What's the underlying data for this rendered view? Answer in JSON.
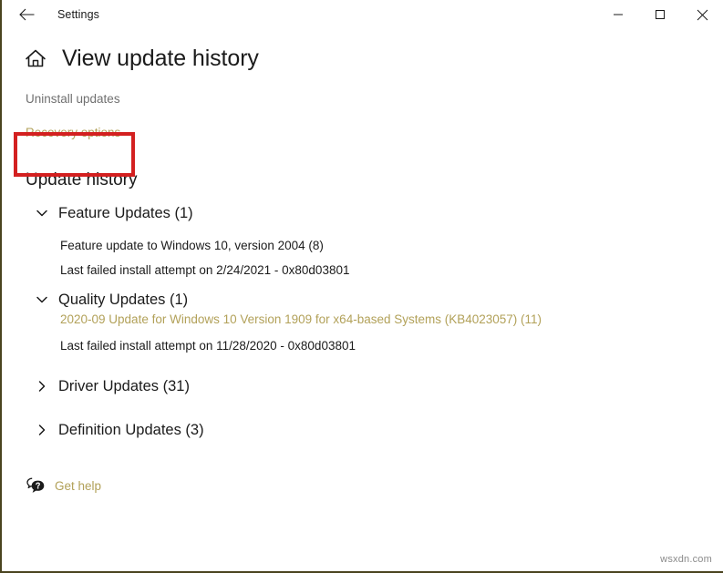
{
  "window": {
    "app_title": "Settings",
    "back_icon": "back-arrow-icon",
    "minimize_label": "Minimize",
    "maximize_label": "Maximize",
    "close_label": "Close"
  },
  "page": {
    "home_icon": "home-icon",
    "title": "View update history",
    "links": [
      {
        "label": "Uninstall updates",
        "color": "#707070",
        "highlighted": true
      },
      {
        "label": "Recovery options",
        "color": "#b2a159",
        "highlighted": false
      }
    ],
    "section_title": "Update history",
    "groups": [
      {
        "label": "Feature Updates (1)",
        "expanded": true,
        "chevron": "chevron-down-icon",
        "items": [
          {
            "name": "Feature update to Windows 10, version 2004 (8)",
            "is_link": false,
            "sub": "Last failed install attempt on 2/24/2021 - 0x80d03801"
          }
        ]
      },
      {
        "label": "Quality Updates (1)",
        "expanded": true,
        "chevron": "chevron-down-icon",
        "items": [
          {
            "name": "2020-09 Update for Windows 10 Version 1909 for x64-based Systems (KB4023057) (11)",
            "is_link": true,
            "sub": "Last failed install attempt on 11/28/2020 - 0x80d03801"
          }
        ]
      },
      {
        "label": "Driver Updates (31)",
        "expanded": false,
        "chevron": "chevron-right-icon",
        "items": []
      },
      {
        "label": "Definition Updates (3)",
        "expanded": false,
        "chevron": "chevron-right-icon",
        "items": []
      }
    ],
    "get_help": {
      "icon": "help-chat-bubble-icon",
      "label": "Get help"
    }
  },
  "annotation": {
    "highlight_color": "#d32020"
  },
  "watermark": "wsxdn.com"
}
